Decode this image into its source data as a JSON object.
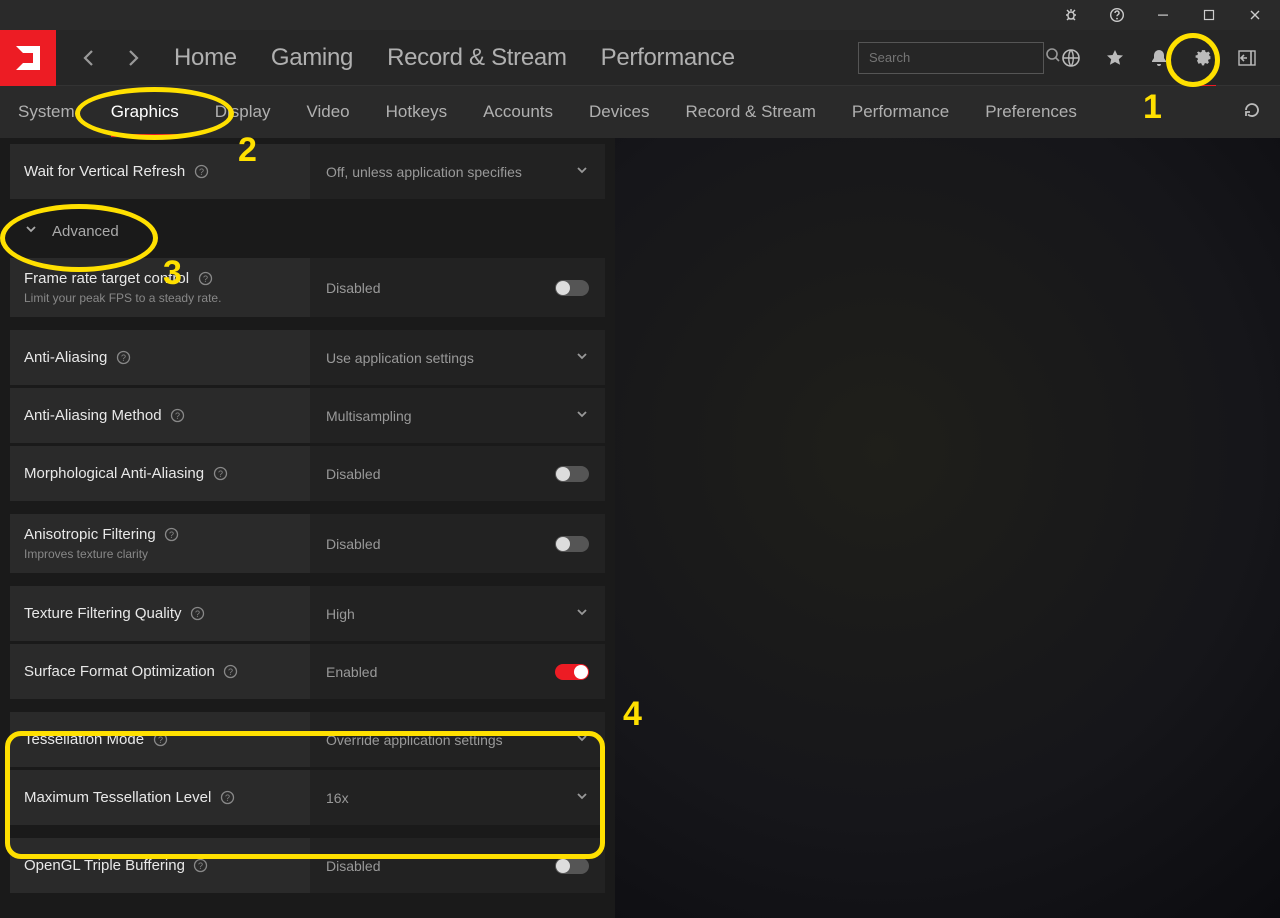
{
  "window": {
    "search_placeholder": "Search"
  },
  "main_tabs": {
    "home": "Home",
    "gaming": "Gaming",
    "record": "Record & Stream",
    "performance": "Performance"
  },
  "sub_tabs": {
    "system": "System",
    "graphics": "Graphics",
    "display": "Display",
    "video": "Video",
    "hotkeys": "Hotkeys",
    "accounts": "Accounts",
    "devices": "Devices",
    "record": "Record & Stream",
    "performance": "Performance",
    "preferences": "Preferences"
  },
  "section": {
    "advanced": "Advanced"
  },
  "settings": {
    "vsync": {
      "label": "Wait for Vertical Refresh",
      "value": "Off, unless application specifies"
    },
    "frtc": {
      "label": "Frame rate target control",
      "sub": "Limit your peak FPS to a steady rate.",
      "value": "Disabled"
    },
    "aa": {
      "label": "Anti-Aliasing",
      "value": "Use application settings"
    },
    "aam": {
      "label": "Anti-Aliasing Method",
      "value": "Multisampling"
    },
    "maa": {
      "label": "Morphological Anti-Aliasing",
      "value": "Disabled"
    },
    "af": {
      "label": "Anisotropic Filtering",
      "sub": "Improves texture clarity",
      "value": "Disabled"
    },
    "tfq": {
      "label": "Texture Filtering Quality",
      "value": "High"
    },
    "sfo": {
      "label": "Surface Format Optimization",
      "value": "Enabled"
    },
    "tess": {
      "label": "Tessellation Mode",
      "value": "Override application settings"
    },
    "maxtess": {
      "label": "Maximum Tessellation Level",
      "value": "16x"
    },
    "ogl": {
      "label": "OpenGL Triple Buffering",
      "value": "Disabled"
    }
  },
  "annotations": {
    "n1": "1",
    "n2": "2",
    "n3": "3",
    "n4": "4"
  }
}
